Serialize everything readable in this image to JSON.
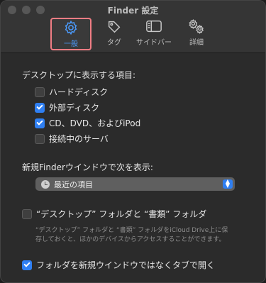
{
  "window": {
    "title": "Finder 設定"
  },
  "toolbar": {
    "tabs": [
      {
        "label": "一般",
        "icon": "gear-icon",
        "selected": true
      },
      {
        "label": "タグ",
        "icon": "tag-icon",
        "selected": false
      },
      {
        "label": "サイドバー",
        "icon": "sidebar-icon",
        "selected": false
      },
      {
        "label": "詳細",
        "icon": "gears-icon",
        "selected": false
      }
    ]
  },
  "desktop_section": {
    "title": "デスクトップに表示する項目:",
    "items": [
      {
        "label": "ハードディスク",
        "checked": false
      },
      {
        "label": "外部ディスク",
        "checked": true
      },
      {
        "label": "CD、DVD、およびiPod",
        "checked": true
      },
      {
        "label": "接続中のサーバ",
        "checked": false
      }
    ]
  },
  "new_window_section": {
    "title": "新規Finderウインドウで次を表示:",
    "selected_value": "最近の項目"
  },
  "icloud": {
    "label": "“デスクトップ” フォルダと “書類” フォルダ",
    "checked": false,
    "description": "“デスクトップ” フォルダと “書類” フォルダをiCloud Drive上に保存しておくと、ほかのデバイスからアクセスすることができます。"
  },
  "tabs_option": {
    "label": "フォルダを新規ウインドウではなくタブで開く",
    "checked": true
  },
  "colors": {
    "accent": "#2f7ff2",
    "highlight_border": "#f07d84"
  }
}
